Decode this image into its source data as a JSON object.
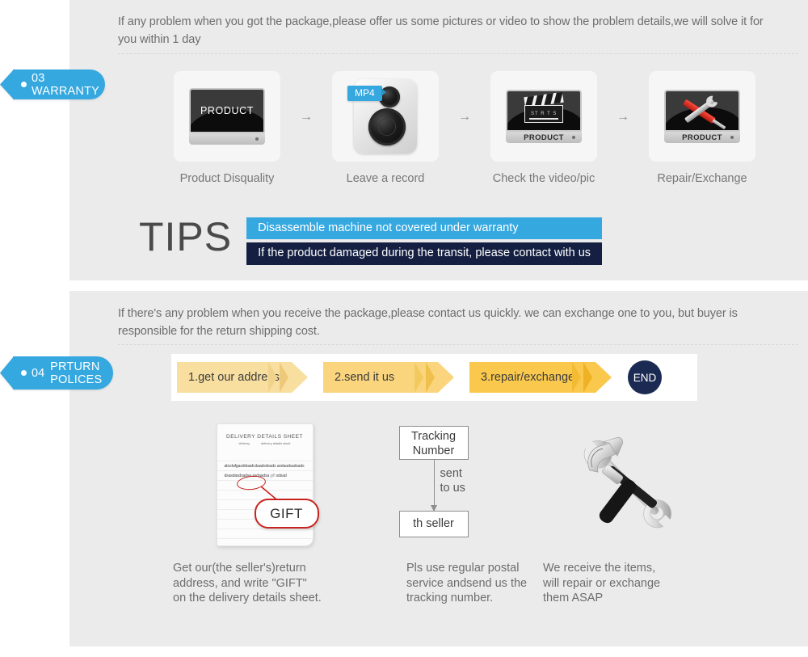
{
  "warranty_section": {
    "intro": "If any problem when you got the package,please offer us some pictures or video to show the problem details,we will solve it for you within 1 day",
    "tag": {
      "number": "03",
      "label": "03 WARRANTY"
    },
    "steps": [
      {
        "caption": "Product Disquality",
        "screen_text": "PRODUCT",
        "icon": "monitor-icon"
      },
      {
        "caption": "Leave a record",
        "badge": "MP4",
        "icon": "camera-icon"
      },
      {
        "caption": "Check the video/pic",
        "bezel_text": "PRODUCT",
        "clapper_text": "ST R T S",
        "icon": "clapperboard-monitor-icon"
      },
      {
        "caption": "Repair/Exchange",
        "bezel_text": "PRODUCT",
        "icon": "repair-tools-monitor-icon"
      }
    ],
    "arrow_glyph": "→",
    "tips": {
      "heading": "TIPS",
      "bars": [
        "Disassemble machine not covered under warranty",
        "If the product damaged during the transit, please contact with us"
      ]
    }
  },
  "returns_section": {
    "intro": "If  there's any problem when you receive the package,please contact us quickly. we can exchange one to you, but buyer is responsible for the return shipping cost.",
    "tag": {
      "number": "04",
      "label": "PRTURN\nPOLICES"
    },
    "steps": [
      {
        "label": "1.get our address"
      },
      {
        "label": "2.send it us"
      },
      {
        "label": "3.repair/exchange"
      }
    ],
    "end_label": "END",
    "columns": [
      {
        "art": "delivery-sheet-illustration",
        "sheet_title": "DELIVERY DETAILS SHEET",
        "sheet_sub_left": "delivery",
        "sheet_sub_right": "delivery details sheet",
        "sheet_body_1": "abcdafgasddaadcdaadsdsads",
        "sheet_body_2": "asdaadsadsadsdsasdasdsadsa",
        "sheet_body_3": "asdaadsa",
        "sheet_body_gift": " gift ",
        "sheet_body_4": "sdsad",
        "callout": "GIFT",
        "caption": "Get our(the seller's)return\naddress, and write \"GIFT\"\non the delivery details sheet."
      },
      {
        "art": "tracking-flow-diagram",
        "box_top": "Tracking\nNumber",
        "arrow_label": "sent\nto us",
        "box_bottom": "th seller",
        "caption": "Pls use regular postal\nservice andsend us the\n tracking number."
      },
      {
        "art": "hammer-wrench-illustration",
        "caption": "We receive the items,\nwill repair or exchange\n them ASAP"
      }
    ]
  },
  "colors": {
    "panel_bg": "#ebebeb",
    "accent_blue": "#35a8e0",
    "tip_navy": "#141f42",
    "end_navy": "#1b2a52",
    "chev_1": "#f8dfa0",
    "chev_2": "#fad57e",
    "chev_3": "#fac84c",
    "red": "#c8241f"
  }
}
